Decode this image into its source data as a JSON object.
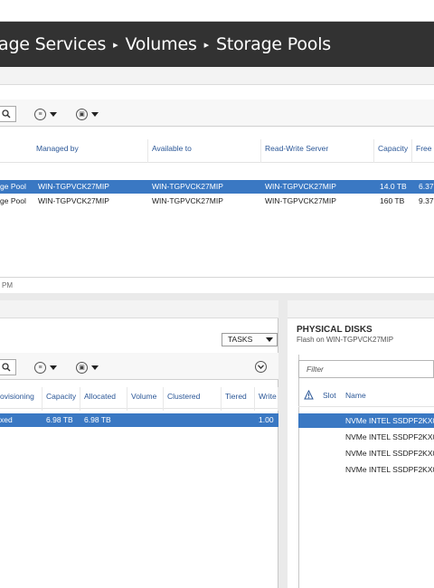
{
  "breadcrumb": {
    "items": [
      "age Services",
      "Volumes",
      "Storage Pools"
    ],
    "separator": "▸"
  },
  "storage_pools": {
    "columns": [
      "Managed by",
      "Available to",
      "Read-Write Server",
      "Capacity",
      "Free"
    ],
    "rows": [
      {
        "name": "ge Pool",
        "managed_by": "WIN-TGPVCK27MIP",
        "available_to": "WIN-TGPVCK27MIP",
        "rw_server": "WIN-TGPVCK27MIP",
        "capacity": "14.0 TB",
        "free": "6.37",
        "selected": true
      },
      {
        "name": "ge Pool",
        "managed_by": "WIN-TGPVCK27MIP",
        "available_to": "WIN-TGPVCK27MIP",
        "rw_server": "WIN-TGPVCK27MIP",
        "capacity": "160 TB",
        "free": "9.37",
        "selected": false
      }
    ],
    "status": "PM"
  },
  "virtual_disks": {
    "tasks_label": "TASKS",
    "columns": [
      "ovisioning",
      "Capacity",
      "Allocated",
      "Volume",
      "Clustered",
      "Tiered",
      "Write"
    ],
    "rows": [
      {
        "provisioning": "xed",
        "capacity": "6.98 TB",
        "allocated": "6.98 TB",
        "volume": "",
        "clustered": "",
        "tiered": "",
        "write": "1.00",
        "selected": true
      }
    ]
  },
  "physical_disks": {
    "title": "PHYSICAL DISKS",
    "subtitle": "Flash on WIN-TGPVCK27MIP",
    "filter_placeholder": "Filter",
    "columns": [
      "Slot",
      "Name"
    ],
    "rows": [
      {
        "name": "NVMe INTEL SSDPF2KX0",
        "selected": true
      },
      {
        "name": "NVMe INTEL SSDPF2KX0",
        "selected": false
      },
      {
        "name": "NVMe INTEL SSDPF2KX0",
        "selected": false
      },
      {
        "name": "NVMe INTEL SSDPF2KX0",
        "selected": false
      }
    ]
  },
  "icons": [
    "search-icon",
    "list-view-icon",
    "save-query-icon",
    "expand-icon",
    "warning-icon",
    "dropdown-arrow-icon"
  ],
  "colors": {
    "titlebar": "#323232",
    "selection": "#3a78c3",
    "header_text": "#2b5797"
  }
}
